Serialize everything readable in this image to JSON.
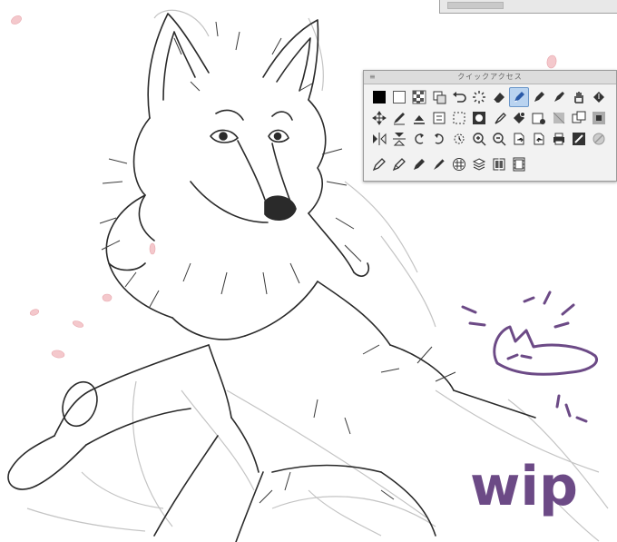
{
  "quick_access": {
    "title": "クイックアクセス",
    "rows": [
      [
        "color-black-swatch",
        "color-white-swatch",
        "transparent-swatch",
        "copy-icon",
        "undo-icon",
        "loading-icon",
        "eraser-icon",
        "pen-tool-icon",
        "pen-icon",
        "ink-pen-icon",
        "hand-icon",
        "fill-icon"
      ],
      [
        "move-icon",
        "pencil-icon",
        "fill-bucket-icon",
        "layer-icon",
        "selection-icon",
        "circle-icon",
        "brush-icon",
        "fill-layer-icon",
        "new-layer-icon",
        "layers-icon",
        "copy-layer-icon",
        "mask-icon"
      ],
      [
        "flip-horizontal-icon",
        "flip-vertical-icon",
        "rotate-left-icon",
        "rotate-right-icon",
        "reset-rotation-icon",
        "zoom-in-icon",
        "zoom-out-icon",
        "export-icon",
        "import-icon",
        "print-icon",
        "frame-icon",
        "no-entry-icon"
      ],
      [
        "pencil-1-icon",
        "pencil-2-icon",
        "pencil-3-icon",
        "pencil-4-icon",
        "texture-icon",
        "layers-stack-icon",
        "panel-icon",
        "film-icon"
      ]
    ],
    "active_index": 7,
    "active_color": "#b9d3f0"
  },
  "doodle": {
    "text": "wip",
    "color": "#6c4a86"
  },
  "colors": {
    "sketch_line": "#2a2a2a",
    "rough_line": "#bdbdbd",
    "petal": "#f4c8cc"
  }
}
